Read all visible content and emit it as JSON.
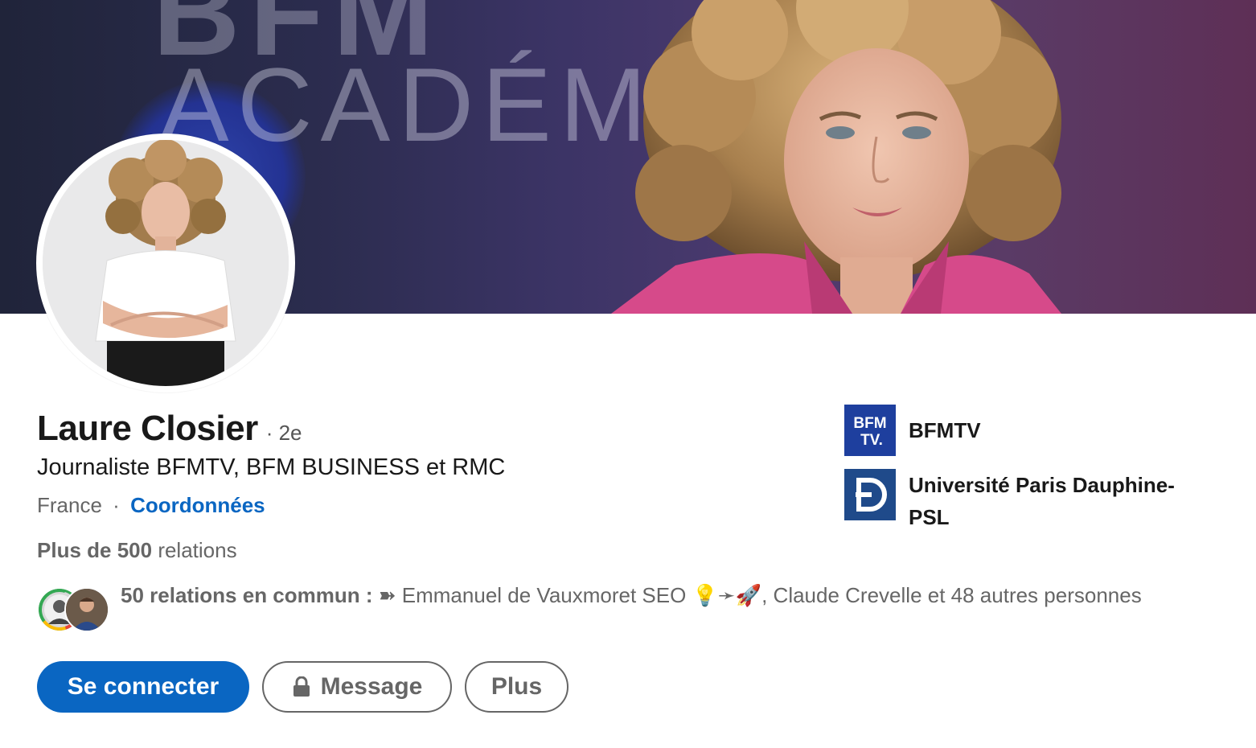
{
  "profile": {
    "name": "Laure Closier",
    "degree": "· 2e",
    "headline": "Journaliste BFMTV, BFM BUSINESS et RMC",
    "location": "France",
    "location_separator": "·",
    "contact_link": "Coordonnées",
    "relations_bold": "Plus de 500",
    "relations_rest": "relations"
  },
  "banner": {
    "brand_letters": "BFM",
    "brand_word": "ACADÉMI"
  },
  "mutual": {
    "bold": "50 relations en commun :",
    "text": "➽ Emmanuel de Vauxmoret SEO 💡➛🚀, Claude Crevelle et 48 autres personnes"
  },
  "actions": {
    "connect": "Se connecter",
    "message": "Message",
    "more": "Plus"
  },
  "organizations": [
    {
      "name": "BFMTV",
      "logo_text_top": "BFM",
      "logo_text_bottom": "TV.",
      "logo_color": "#1e3f9e"
    },
    {
      "name": "Université Paris Dauphine-PSL",
      "logo_text": "D",
      "logo_color": "#1f4a8a"
    }
  ],
  "colors": {
    "primary": "#0a66c2",
    "text": "#191919",
    "muted": "#666666"
  }
}
